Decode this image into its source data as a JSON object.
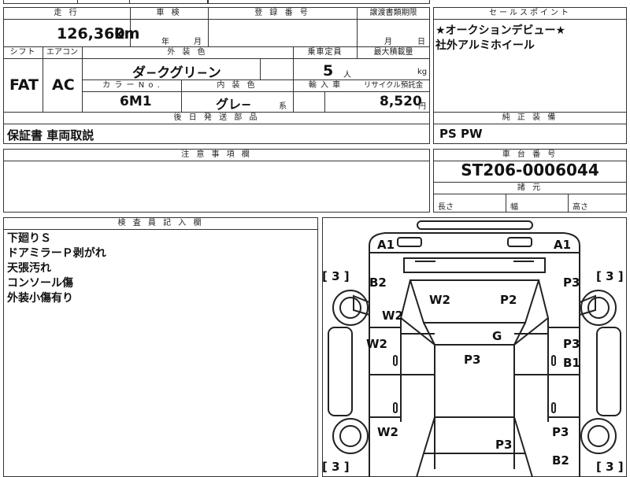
{
  "top_strip": {
    "partial": "日 付"
  },
  "headers": {
    "mileage": "走 行",
    "inspection": "車 検",
    "registration": "登 録 番 号",
    "transfer_deadline": "譲渡書類期限",
    "sales_point": "セールスポイント",
    "shift": "シフト",
    "aircon": "エアコン",
    "exterior_color": "外 装 色",
    "capacity": "乗車定員",
    "max_load": "最大積載量",
    "color_no": "カ ラ ー  N o .",
    "interior_color": "内 装 色",
    "import": "輸 入 車",
    "recycle": "リサイクル預託金",
    "later_parts": "後 日 発 送 部 品",
    "standard_equipment": "純 正 装 備",
    "notes": "注 意 事 項 欄",
    "chassis_no": "車 台 番 号",
    "dimensions": "諸 元",
    "inspector": "検 査 員 記 入 欄"
  },
  "values": {
    "mileage": "126,360",
    "mileage_unit": "km",
    "inspection_year_unit": "年",
    "inspection_month_unit": "月",
    "deadline_month_unit": "月",
    "deadline_day_unit": "日",
    "shift": "FAT",
    "aircon": "AC",
    "exterior_color": "ダ−クグリ−ン",
    "capacity": "5",
    "capacity_unit": "人",
    "max_load_unit": "kg",
    "color_no": "6M1",
    "interior_color": "グレ−",
    "interior_suffix": "系",
    "recycle_fee": "8,520",
    "recycle_unit": "円",
    "later_parts": "保証書 車両取説",
    "standard_equipment": "PS PW",
    "chassis_no": "ST206-0006044",
    "length_label": "長さ",
    "width_label": "幅",
    "height_label": "高さ"
  },
  "sales_points": [
    "★オークションデビュー★",
    "社外アルミホイール"
  ],
  "inspector_notes": [
    "下廻りＳ",
    "ドアミラーＰ剥がれ",
    "天張汚れ",
    "コンソール傷",
    "外装小傷有り"
  ],
  "damage_marks": {
    "front_left": "A1",
    "front_right": "A1",
    "left_front_fender_bracket": "[ 3 ]",
    "right_front_fender_bracket": "[ 3 ]",
    "left_rear_fender_bracket": "[ 3 ]",
    "right_rear_fender_bracket": "[ 3 ]",
    "left_front_fender": "B2",
    "right_front_fender": "P3",
    "windshield": "W2",
    "hood": "P2",
    "left_front_window": "W2",
    "left_front_door_window": "W2",
    "roof": "G",
    "roof_panel": "P3",
    "right_front_door": "P3",
    "right_front_door_2": "B1",
    "left_rear_window": "W2",
    "right_rear_door": "P3",
    "trunk": "P3",
    "right_rear_fender": "B2"
  }
}
